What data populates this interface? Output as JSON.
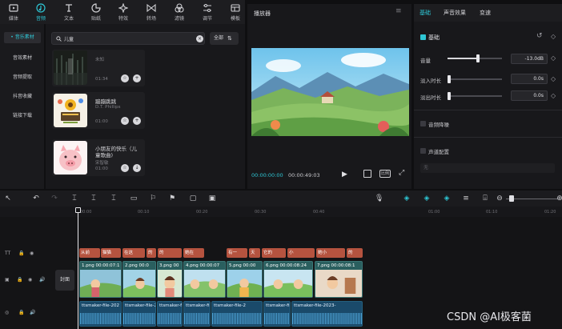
{
  "toolbar": {
    "items": [
      {
        "label": "媒体",
        "icon": "media-icon"
      },
      {
        "label": "音频",
        "icon": "audio-icon",
        "active": true
      },
      {
        "label": "文本",
        "icon": "text-icon"
      },
      {
        "label": "贴纸",
        "icon": "sticker-icon"
      },
      {
        "label": "特效",
        "icon": "effects-icon"
      },
      {
        "label": "转场",
        "icon": "transition-icon"
      },
      {
        "label": "滤镜",
        "icon": "filter-icon"
      },
      {
        "label": "调节",
        "icon": "adjust-icon"
      },
      {
        "label": "模板",
        "icon": "template-icon"
      }
    ]
  },
  "subnav": {
    "items": [
      "• 音乐素材",
      "音效素材",
      "音频提取",
      "抖音收藏",
      "链接下载"
    ]
  },
  "library": {
    "search_value": "儿童",
    "all_label": "全部",
    "cards": [
      {
        "title": "",
        "artist": "未知",
        "duration": "01:34"
      },
      {
        "title": "蹦蹦跳跳",
        "artist": "D.T. Phillips",
        "duration": "01:00"
      },
      {
        "title": "小朋友的快乐（儿",
        "title2": "童歌曲)",
        "artist": "宋智敏",
        "duration": "01:00"
      }
    ]
  },
  "player": {
    "title": "播放器",
    "current_time": "00:00:00:00",
    "total_time": "00:00:49:03",
    "ratio_label": "比例"
  },
  "props": {
    "tabs": [
      "基础",
      "声音效果",
      "变速"
    ],
    "section_basic": "基础",
    "volume_label": "音量",
    "volume_value": "-13.0dB",
    "fadein_label": "淡入时长",
    "fadein_value": "0.0s",
    "fadeout_label": "淡出时长",
    "fadeout_value": "0.0s",
    "denoise_label": "音频降噪",
    "voice_label": "声道配置",
    "voice_value": "无"
  },
  "timeline": {
    "ruler": [
      "00:00",
      "00:10",
      "00:20",
      "00:30",
      "00:40",
      "01:00",
      "01:10",
      "01:20"
    ],
    "cover_label": "封面",
    "text_clips": [
      "从前",
      "猫猫",
      "在这",
      "的",
      "的",
      "她在",
      "有一",
      "天",
      "它的",
      "小",
      "她小",
      "的"
    ],
    "video_clips": [
      {
        "label": "1.png 00:00:07:1"
      },
      {
        "label": "2.png 00:0"
      },
      {
        "label": "3.png 00"
      },
      {
        "label": "4.png 00:00:07"
      },
      {
        "label": "5.png 00:00"
      },
      {
        "label": "6.png 00:00:08:24"
      },
      {
        "label": "7.png 00:00:08:1"
      }
    ],
    "audio_clips": [
      "ttsmaker-file-202",
      "ttsmaker-file-202",
      "ttsmaker-f",
      "ttsmaker-fi",
      "ttsmaker-file-2",
      "ttsmaker-fi",
      "ttsmaker-file-2023-"
    ]
  },
  "watermark": "CSDN @AI极客菌"
}
